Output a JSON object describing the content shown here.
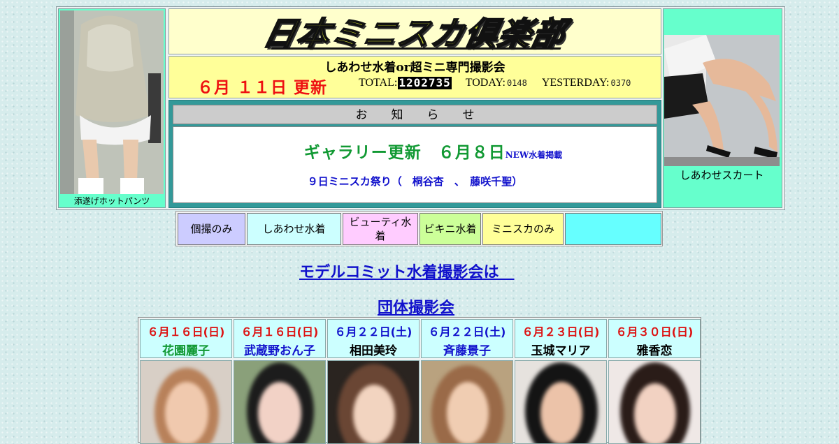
{
  "header": {
    "site_title": "日本ミニスカ倶楽部",
    "subtitle": "しあわせ水着or超ミニ専門撮影会",
    "update_date": "６月 １１日 更新",
    "counters": {
      "total_label": "TOTAL:",
      "total_value": "1202735",
      "today_label": "TODAY:",
      "today_value": "0148",
      "yesterday_label": "YESTERDAY:",
      "yesterday_value": "0370"
    },
    "left_caption": "添遂げホットパンツ",
    "right_caption": "しあわせスカート"
  },
  "notice": {
    "heading": "お　　知　　ら　　せ",
    "gallery": "ギャラリー更新　６月８日",
    "gallery_tag": "NEW水着掲載",
    "event_line": "９日ミニスカ祭り（　桐谷杏　、　藤咲千聖）"
  },
  "nav": [
    {
      "label": "個撮のみ",
      "bg": "#ccccff"
    },
    {
      "label": "しあわせ水着",
      "bg": "#ccffff"
    },
    {
      "label": "ビューティ水着",
      "bg": "#ffccff"
    },
    {
      "label": "ビキニ水着",
      "bg": "#ccff99"
    },
    {
      "label": "ミニスカのみ",
      "bg": "#ffff99"
    },
    {
      "label": "",
      "bg": "#66ffff"
    }
  ],
  "links": {
    "commit_label": "モデルコミット水着撮影会は　",
    "group_label": "団体撮影会"
  },
  "schedule": [
    {
      "date": "６月１６日(日)",
      "name": "花園麗子",
      "date_color": "#dd1111",
      "name_color": "#119933"
    },
    {
      "date": "６月１６日(日)",
      "name": "武蔵野おん子",
      "date_color": "#dd1111",
      "name_color": "#1111cc"
    },
    {
      "date": "６月２２日(土)",
      "name": "相田美玲",
      "date_color": "#1111cc",
      "name_color": "#000000"
    },
    {
      "date": "６月２２日(土)",
      "name": "斉藤景子",
      "date_color": "#1111cc",
      "name_color": "#1111cc"
    },
    {
      "date": "６月２３日(日)",
      "name": "玉城マリア",
      "date_color": "#dd1111",
      "name_color": "#000000"
    },
    {
      "date": "６月３０日(日)",
      "name": "雅香恋",
      "date_color": "#dd1111",
      "name_color": "#000000"
    }
  ]
}
